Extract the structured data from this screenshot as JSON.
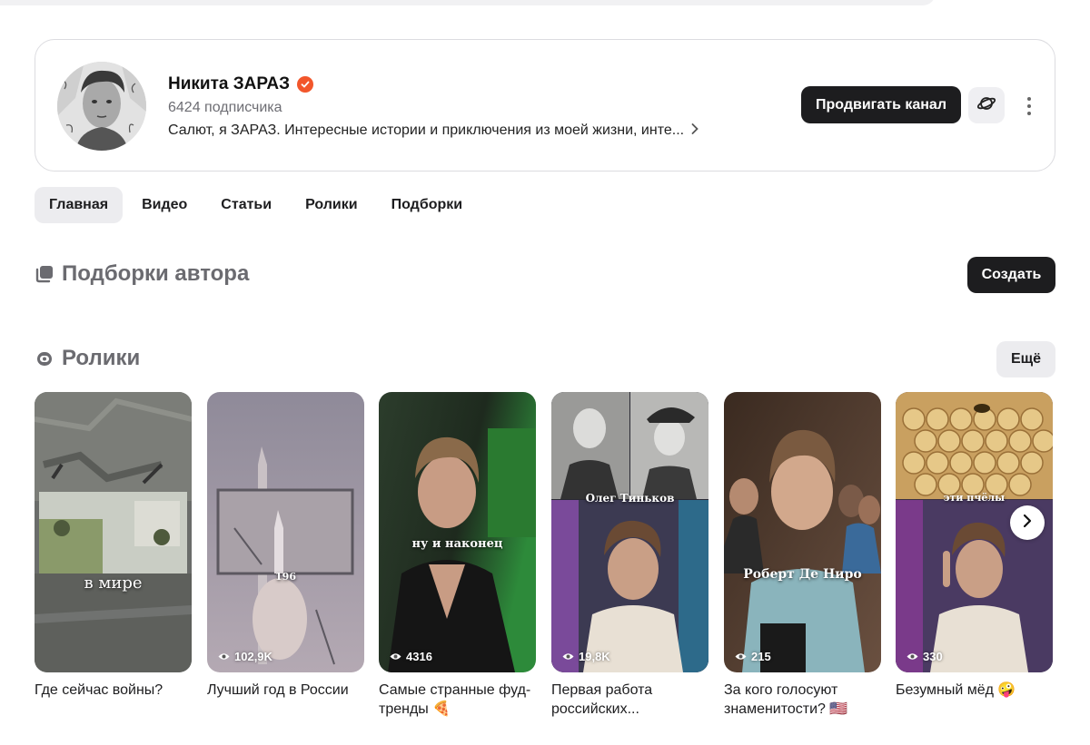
{
  "channel": {
    "name": "Никита ЗАРАЗ",
    "subscribers": "6424 подписчика",
    "description": "Салют, я ЗАРАЗ. Интересные истории и приключения из моей жизни, инте...",
    "promote_label": "Продвигать канал",
    "verified_icon": "verified-check-icon",
    "planet_icon": "planet-icon",
    "more_icon": "more-vertical-icon"
  },
  "tabs": [
    {
      "label": "Главная",
      "active": true
    },
    {
      "label": "Видео",
      "active": false
    },
    {
      "label": "Статьи",
      "active": false
    },
    {
      "label": "Ролики",
      "active": false
    },
    {
      "label": "Подборки",
      "active": false
    }
  ],
  "collections": {
    "title": "Подборки автора",
    "create_label": "Создать",
    "icon": "collections-icon"
  },
  "shorts": {
    "title": "Ролики",
    "more_label": "Ещё",
    "icon": "shorts-icon",
    "items": [
      {
        "title": "Где сейчас войны?",
        "views": "",
        "overlay": "в мире"
      },
      {
        "title": "Лучший год в России",
        "views": "102,9K",
        "overlay": "196"
      },
      {
        "title": "Самые странные фуд-тренды 🍕",
        "views": "4316",
        "overlay": "ну и наконец"
      },
      {
        "title": "Первая работа российских...",
        "views": "19,8K",
        "overlay": "Олег Тиньков"
      },
      {
        "title": "За кого голосуют знаменитости? 🇺🇸",
        "views": "215",
        "overlay": "Роберт Де Ниро"
      },
      {
        "title": "Безумный мёд 🤪",
        "views": "330",
        "overlay": "эти пчёлы"
      }
    ]
  },
  "colors": {
    "accent": "#f2562b",
    "button_dark": "#1d1d1f",
    "muted_text": "#6b6b70"
  }
}
